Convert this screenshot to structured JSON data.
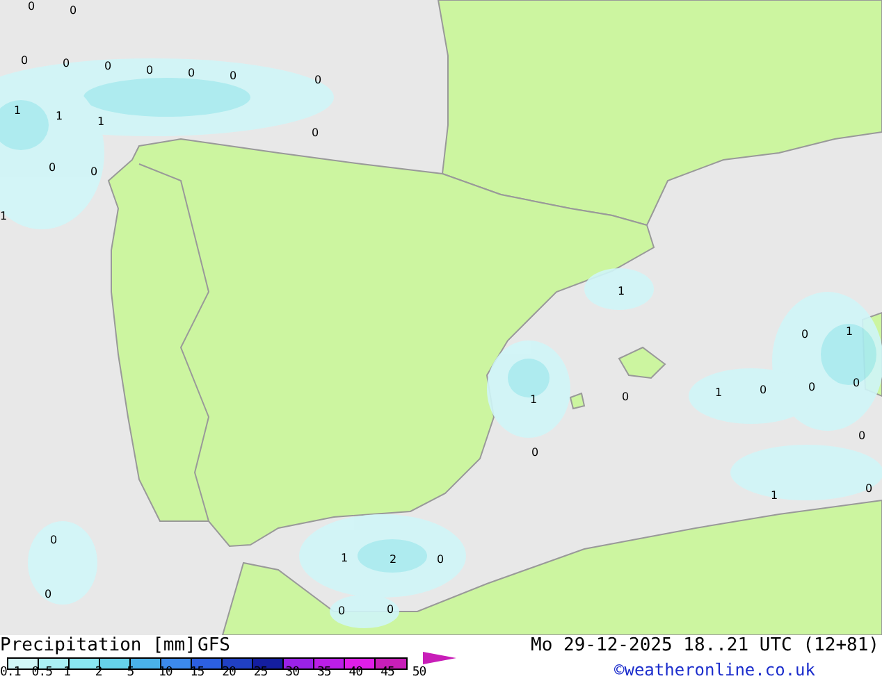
{
  "map": {
    "labels": [
      {
        "text": "0"
      },
      {
        "text": "0"
      },
      {
        "text": "0"
      },
      {
        "text": "0"
      },
      {
        "text": "0"
      },
      {
        "text": "0"
      },
      {
        "text": "0"
      },
      {
        "text": "0"
      },
      {
        "text": "0"
      },
      {
        "text": "1"
      },
      {
        "text": "1"
      },
      {
        "text": "1"
      },
      {
        "text": "0"
      },
      {
        "text": "0"
      },
      {
        "text": "0"
      },
      {
        "text": "1"
      },
      {
        "text": "1"
      },
      {
        "text": "0"
      },
      {
        "text": "1"
      },
      {
        "text": "1"
      },
      {
        "text": "0"
      },
      {
        "text": "1"
      },
      {
        "text": "0"
      },
      {
        "text": "0"
      },
      {
        "text": "0"
      },
      {
        "text": "0"
      },
      {
        "text": "0"
      },
      {
        "text": "1"
      },
      {
        "text": "0"
      },
      {
        "text": "0"
      },
      {
        "text": "1"
      },
      {
        "text": "2"
      },
      {
        "text": "0"
      },
      {
        "text": "0"
      },
      {
        "text": "0"
      },
      {
        "text": "0"
      }
    ]
  },
  "legend": {
    "title": "Precipitation [mm]",
    "model": "GFS",
    "swatches": [
      {
        "color": "#d2f8f8"
      },
      {
        "color": "#aaf0f4"
      },
      {
        "color": "#8ae6f0"
      },
      {
        "color": "#66d2ea"
      },
      {
        "color": "#4ab2ea"
      },
      {
        "color": "#3c8aec"
      },
      {
        "color": "#2c60e0"
      },
      {
        "color": "#2040c4"
      },
      {
        "color": "#141ea0"
      },
      {
        "color": "#9a22e8"
      },
      {
        "color": "#bc1ee8"
      },
      {
        "color": "#e01ee8"
      },
      {
        "color": "#c81eb8"
      }
    ],
    "ticks": [
      "0.1",
      "0.5",
      "1",
      "2",
      "5",
      "10",
      "15",
      "20",
      "25",
      "30",
      "35",
      "40",
      "45",
      "50"
    ]
  },
  "valid_time": "Mo 29-12-2025 18..21 UTC (12+81)",
  "credit": "©weatheronline.co.uk"
}
